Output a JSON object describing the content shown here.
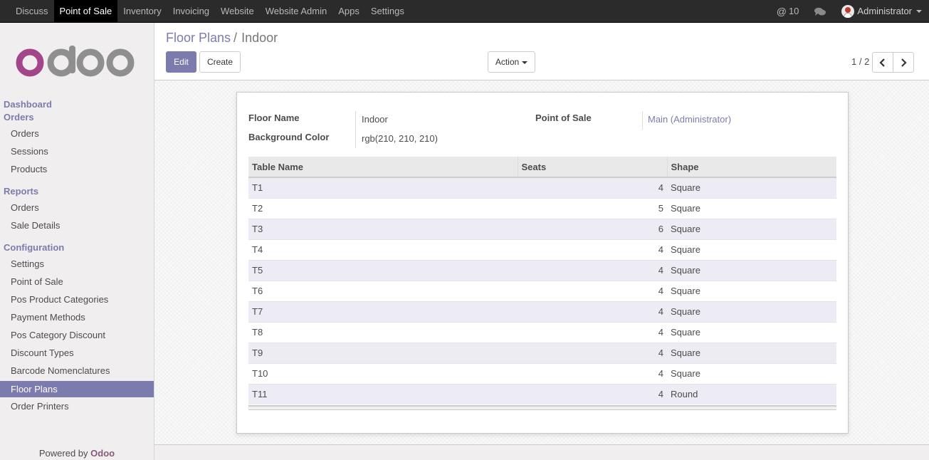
{
  "topbar": {
    "menu": [
      "Discuss",
      "Point of Sale",
      "Inventory",
      "Invoicing",
      "Website",
      "Website Admin",
      "Apps",
      "Settings"
    ],
    "active_menu": "Point of Sale",
    "mentions_count": "10",
    "user_name": "Administrator"
  },
  "sidebar": {
    "logo_text": "odoo",
    "sections": [
      {
        "title": "Dashboard",
        "items": []
      },
      {
        "title": "Orders",
        "items": [
          "Orders",
          "Sessions",
          "Products"
        ]
      },
      {
        "title": "Reports",
        "items": [
          "Orders",
          "Sale Details"
        ]
      },
      {
        "title": "Configuration",
        "items": [
          "Settings",
          "Point of Sale",
          "Pos Product Categories",
          "Payment Methods",
          "Pos Category Discount",
          "Discount Types",
          "Barcode Nomenclatures",
          "Floor Plans",
          "Order Printers"
        ]
      }
    ],
    "active_item": "Floor Plans",
    "powered_by": "Powered by",
    "powered_brand": "Odoo"
  },
  "control_panel": {
    "breadcrumb_parent": "Floor Plans",
    "breadcrumb_sep": "/",
    "breadcrumb_current": "Indoor",
    "edit_label": "Edit",
    "create_label": "Create",
    "action_label": "Action",
    "pager": "1 / 2"
  },
  "form": {
    "floor_name_label": "Floor Name",
    "floor_name_value": "Indoor",
    "background_color_label": "Background Color",
    "background_color_value": "rgb(210, 210, 210)",
    "pos_label": "Point of Sale",
    "pos_value": "Main (Administrator)"
  },
  "table": {
    "headers": [
      "Table Name",
      "Seats",
      "Shape"
    ],
    "rows": [
      [
        "T1",
        "4",
        "Square"
      ],
      [
        "T2",
        "5",
        "Square"
      ],
      [
        "T3",
        "6",
        "Square"
      ],
      [
        "T4",
        "4",
        "Square"
      ],
      [
        "T5",
        "4",
        "Square"
      ],
      [
        "T6",
        "4",
        "Square"
      ],
      [
        "T7",
        "4",
        "Square"
      ],
      [
        "T8",
        "4",
        "Square"
      ],
      [
        "T9",
        "4",
        "Square"
      ],
      [
        "T10",
        "4",
        "Square"
      ],
      [
        "T11",
        "4",
        "Round"
      ]
    ]
  },
  "colors": {
    "accent": "#7c7bad",
    "brand": "#875a7b",
    "topbar": "#2b2b2b",
    "sidebar": "#f0eeee"
  }
}
